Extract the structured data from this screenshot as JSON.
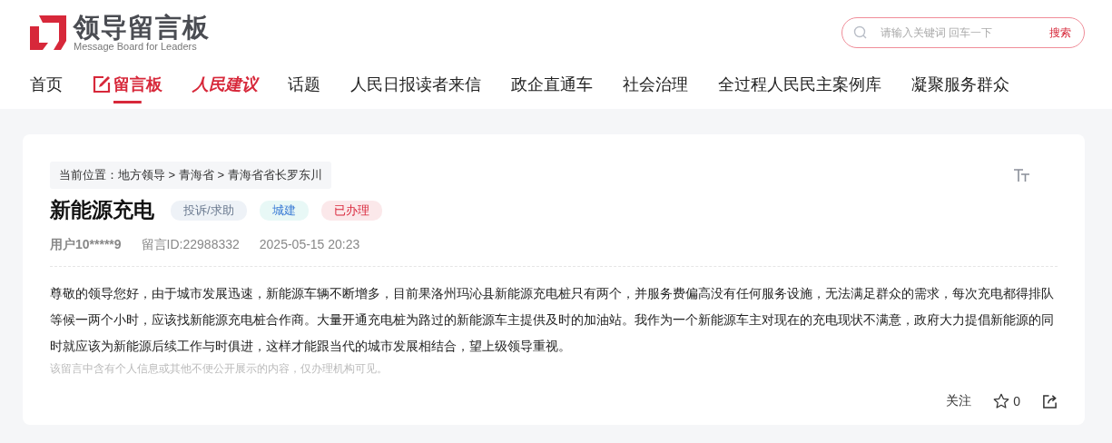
{
  "header": {
    "logo_title": "领导留言板",
    "logo_subtitle": "Message Board for Leaders",
    "search": {
      "placeholder": "请输入关键词 回车一下",
      "button": "搜索"
    }
  },
  "nav": [
    {
      "label": "首页",
      "kind": "text",
      "selected": false
    },
    {
      "label": "留言板",
      "kind": "icon",
      "selected": true
    },
    {
      "label": "人民建议",
      "kind": "brand",
      "selected": false
    },
    {
      "label": "话题",
      "kind": "text",
      "selected": false
    },
    {
      "label": "人民日报读者来信",
      "kind": "text",
      "selected": false
    },
    {
      "label": "政企直通车",
      "kind": "text",
      "selected": false
    },
    {
      "label": "社会治理",
      "kind": "text",
      "selected": false
    },
    {
      "label": "全过程人民民主案例库",
      "kind": "text",
      "selected": false
    },
    {
      "label": "凝聚服务群众",
      "kind": "text",
      "selected": false
    }
  ],
  "breadcrumb": "当前位置：地方领导 > 青海省 > 青海省省长罗东川",
  "message": {
    "title": "新能源充电",
    "tags": [
      {
        "label": "投诉/求助",
        "color": "#eef2f7"
      },
      {
        "label": "城建",
        "color": "#e8f8f6"
      },
      {
        "label": "已办理",
        "color": "#fbe8ea"
      }
    ],
    "user": "用户10*****9",
    "id": "留言ID:22988332",
    "time": "2025-05-15 20:23",
    "body": "尊敬的领导您好，由于城市发展迅速，新能源车辆不断增多，目前果洛州玛沁县新能源充电桩只有两个，并服务费偏高没有任何服务设施，无法满足群众的需求，每次充电都得排队等候一两个小时，应该找新能源充电桩合作商。大量开通充电桩为路过的新能源车主提供及时的加油站。我作为一个新能源车主对现在的充电现状不满意，政府大力提倡新能源的同时就应该为新能源后续工作与时俱进，这样才能跟当代的城市发展相结合，望上级领导重视。",
    "notice": "该留言中含有个人信息或其他不便公开展示的内容，仅办理机构可见。",
    "follow": "关注",
    "likes": "0"
  }
}
